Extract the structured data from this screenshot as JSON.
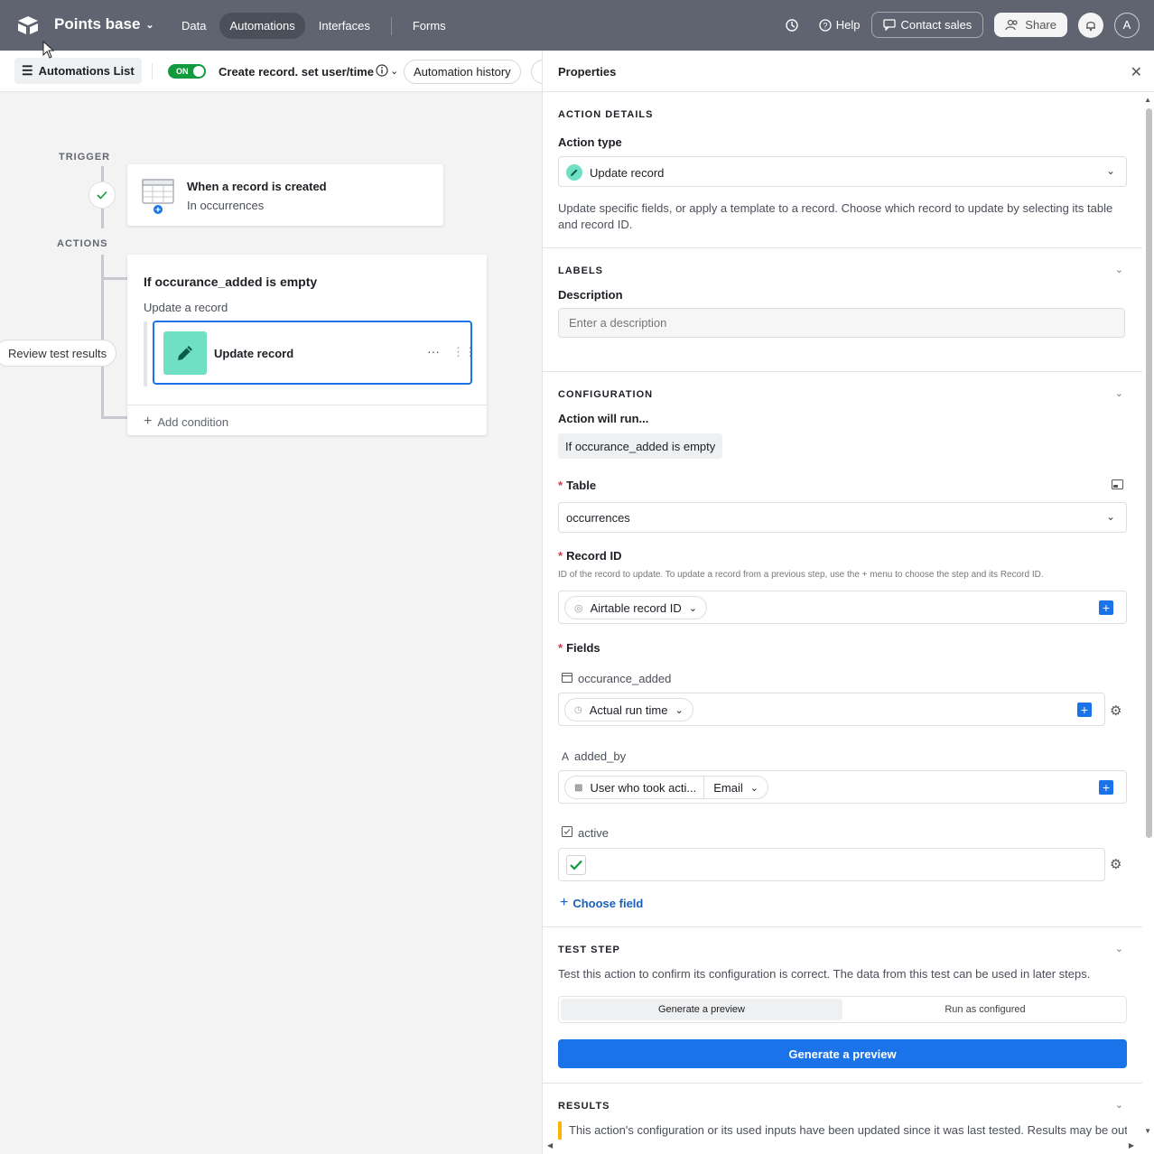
{
  "topbar": {
    "base_name": "Points base",
    "nav": [
      "Data",
      "Automations",
      "Interfaces",
      "Forms"
    ],
    "help": "Help",
    "contact_sales": "Contact sales",
    "share": "Share",
    "avatar_initial": "A",
    "bg_color": "#5f6470"
  },
  "subbar": {
    "list_button": "Automations List",
    "toggle": "ON",
    "automation_name": "Create record. set user/time",
    "history": "Automation history"
  },
  "canvas": {
    "trigger_label": "TRIGGER",
    "actions_label": "ACTIONS",
    "trigger_title": "When a record is created",
    "trigger_sub": "In occurrences",
    "condition_title": "If occurance_added is empty",
    "condition_sub": "Update a record",
    "action_label": "Update record",
    "add_condition": "Add condition",
    "review": "Review test results"
  },
  "panel": {
    "title": "Properties",
    "action_details": "ACTION DETAILS",
    "action_type_label": "Action type",
    "action_type_value": "Update record",
    "action_desc": "Update specific fields, or apply a template to a record. Choose which record to update by selecting its table and record ID.",
    "labels": "LABELS",
    "description_label": "Description",
    "description_placeholder": "Enter a description",
    "configuration": "CONFIGURATION",
    "will_run": "Action will run...",
    "cond_if": "If",
    "cond_field": "occurance_added",
    "cond_rest": "is empty",
    "table_label": "Table",
    "table_value": "occurrences",
    "record_id_label": "Record ID",
    "record_id_help": "ID of the record to update. To update a record from a previous step, use the + menu to choose the step and its Record ID.",
    "record_id_pill": "Airtable record ID",
    "fields_label": "Fields",
    "field1_name": "occurance_added",
    "field1_pill": "Actual run time",
    "field2_name": "added_by",
    "field2_pill": "User who took acti...",
    "field2_pill2": "Email",
    "field3_name": "active",
    "choose_field": "Choose field",
    "test_step": "TEST STEP",
    "test_desc": "Test this action to confirm its configuration is correct. The data from this test can be used in later steps.",
    "seg_preview": "Generate a preview",
    "seg_run": "Run as configured",
    "primary": "Generate a preview",
    "results": "RESULTS",
    "warning": "This action's configuration or its used inputs have been updated since it was last tested. Results may be out"
  },
  "colors": {
    "accent": "#1a73e8",
    "success": "#139a3f",
    "action_icon": "#6fe0c4",
    "warning": "#fcb400"
  }
}
